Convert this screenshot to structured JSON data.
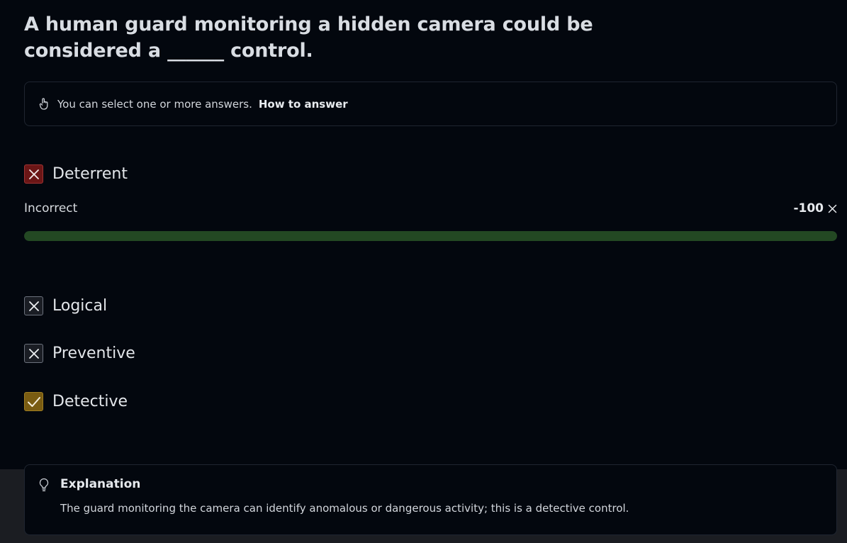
{
  "question": {
    "text": "A human guard monitoring a hidden camera could be considered a ______ control."
  },
  "hint": {
    "icon": "pointer-hand-icon",
    "text": "You can select one or more answers.",
    "link": "How to answer"
  },
  "options": [
    {
      "label": "Deterrent",
      "state": "selected-incorrect",
      "color": "#6b1616"
    },
    {
      "label": "Logical",
      "state": "incorrect"
    },
    {
      "label": "Preventive",
      "state": "incorrect"
    },
    {
      "label": "Detective",
      "state": "correct",
      "color": "#7a5c12"
    }
  ],
  "result": {
    "label": "Incorrect",
    "score": "-100",
    "progress_fraction": 1.0,
    "progress_color": "#234823"
  },
  "explanation": {
    "icon": "lightbulb-icon",
    "title": "Explanation",
    "text": "The guard monitoring the camera can identify anomalous or dangerous activity; this is a detective control."
  }
}
